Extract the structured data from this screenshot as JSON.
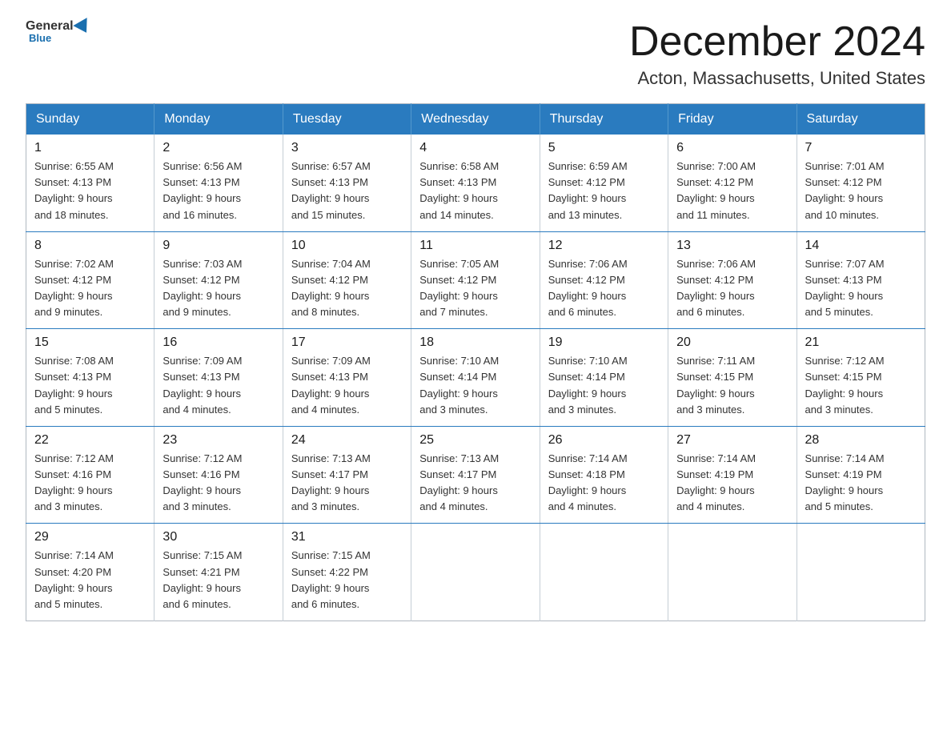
{
  "header": {
    "logo_general": "General",
    "logo_blue": "Blue",
    "month_title": "December 2024",
    "location": "Acton, Massachusetts, United States"
  },
  "days_of_week": [
    "Sunday",
    "Monday",
    "Tuesday",
    "Wednesday",
    "Thursday",
    "Friday",
    "Saturday"
  ],
  "weeks": [
    [
      {
        "day": "1",
        "sunrise": "6:55 AM",
        "sunset": "4:13 PM",
        "daylight": "9 hours and 18 minutes."
      },
      {
        "day": "2",
        "sunrise": "6:56 AM",
        "sunset": "4:13 PM",
        "daylight": "9 hours and 16 minutes."
      },
      {
        "day": "3",
        "sunrise": "6:57 AM",
        "sunset": "4:13 PM",
        "daylight": "9 hours and 15 minutes."
      },
      {
        "day": "4",
        "sunrise": "6:58 AM",
        "sunset": "4:13 PM",
        "daylight": "9 hours and 14 minutes."
      },
      {
        "day": "5",
        "sunrise": "6:59 AM",
        "sunset": "4:12 PM",
        "daylight": "9 hours and 13 minutes."
      },
      {
        "day": "6",
        "sunrise": "7:00 AM",
        "sunset": "4:12 PM",
        "daylight": "9 hours and 11 minutes."
      },
      {
        "day": "7",
        "sunrise": "7:01 AM",
        "sunset": "4:12 PM",
        "daylight": "9 hours and 10 minutes."
      }
    ],
    [
      {
        "day": "8",
        "sunrise": "7:02 AM",
        "sunset": "4:12 PM",
        "daylight": "9 hours and 9 minutes."
      },
      {
        "day": "9",
        "sunrise": "7:03 AM",
        "sunset": "4:12 PM",
        "daylight": "9 hours and 9 minutes."
      },
      {
        "day": "10",
        "sunrise": "7:04 AM",
        "sunset": "4:12 PM",
        "daylight": "9 hours and 8 minutes."
      },
      {
        "day": "11",
        "sunrise": "7:05 AM",
        "sunset": "4:12 PM",
        "daylight": "9 hours and 7 minutes."
      },
      {
        "day": "12",
        "sunrise": "7:06 AM",
        "sunset": "4:12 PM",
        "daylight": "9 hours and 6 minutes."
      },
      {
        "day": "13",
        "sunrise": "7:06 AM",
        "sunset": "4:12 PM",
        "daylight": "9 hours and 6 minutes."
      },
      {
        "day": "14",
        "sunrise": "7:07 AM",
        "sunset": "4:13 PM",
        "daylight": "9 hours and 5 minutes."
      }
    ],
    [
      {
        "day": "15",
        "sunrise": "7:08 AM",
        "sunset": "4:13 PM",
        "daylight": "9 hours and 5 minutes."
      },
      {
        "day": "16",
        "sunrise": "7:09 AM",
        "sunset": "4:13 PM",
        "daylight": "9 hours and 4 minutes."
      },
      {
        "day": "17",
        "sunrise": "7:09 AM",
        "sunset": "4:13 PM",
        "daylight": "9 hours and 4 minutes."
      },
      {
        "day": "18",
        "sunrise": "7:10 AM",
        "sunset": "4:14 PM",
        "daylight": "9 hours and 3 minutes."
      },
      {
        "day": "19",
        "sunrise": "7:10 AM",
        "sunset": "4:14 PM",
        "daylight": "9 hours and 3 minutes."
      },
      {
        "day": "20",
        "sunrise": "7:11 AM",
        "sunset": "4:15 PM",
        "daylight": "9 hours and 3 minutes."
      },
      {
        "day": "21",
        "sunrise": "7:12 AM",
        "sunset": "4:15 PM",
        "daylight": "9 hours and 3 minutes."
      }
    ],
    [
      {
        "day": "22",
        "sunrise": "7:12 AM",
        "sunset": "4:16 PM",
        "daylight": "9 hours and 3 minutes."
      },
      {
        "day": "23",
        "sunrise": "7:12 AM",
        "sunset": "4:16 PM",
        "daylight": "9 hours and 3 minutes."
      },
      {
        "day": "24",
        "sunrise": "7:13 AM",
        "sunset": "4:17 PM",
        "daylight": "9 hours and 3 minutes."
      },
      {
        "day": "25",
        "sunrise": "7:13 AM",
        "sunset": "4:17 PM",
        "daylight": "9 hours and 4 minutes."
      },
      {
        "day": "26",
        "sunrise": "7:14 AM",
        "sunset": "4:18 PM",
        "daylight": "9 hours and 4 minutes."
      },
      {
        "day": "27",
        "sunrise": "7:14 AM",
        "sunset": "4:19 PM",
        "daylight": "9 hours and 4 minutes."
      },
      {
        "day": "28",
        "sunrise": "7:14 AM",
        "sunset": "4:19 PM",
        "daylight": "9 hours and 5 minutes."
      }
    ],
    [
      {
        "day": "29",
        "sunrise": "7:14 AM",
        "sunset": "4:20 PM",
        "daylight": "9 hours and 5 minutes."
      },
      {
        "day": "30",
        "sunrise": "7:15 AM",
        "sunset": "4:21 PM",
        "daylight": "9 hours and 6 minutes."
      },
      {
        "day": "31",
        "sunrise": "7:15 AM",
        "sunset": "4:22 PM",
        "daylight": "9 hours and 6 minutes."
      },
      null,
      null,
      null,
      null
    ]
  ]
}
